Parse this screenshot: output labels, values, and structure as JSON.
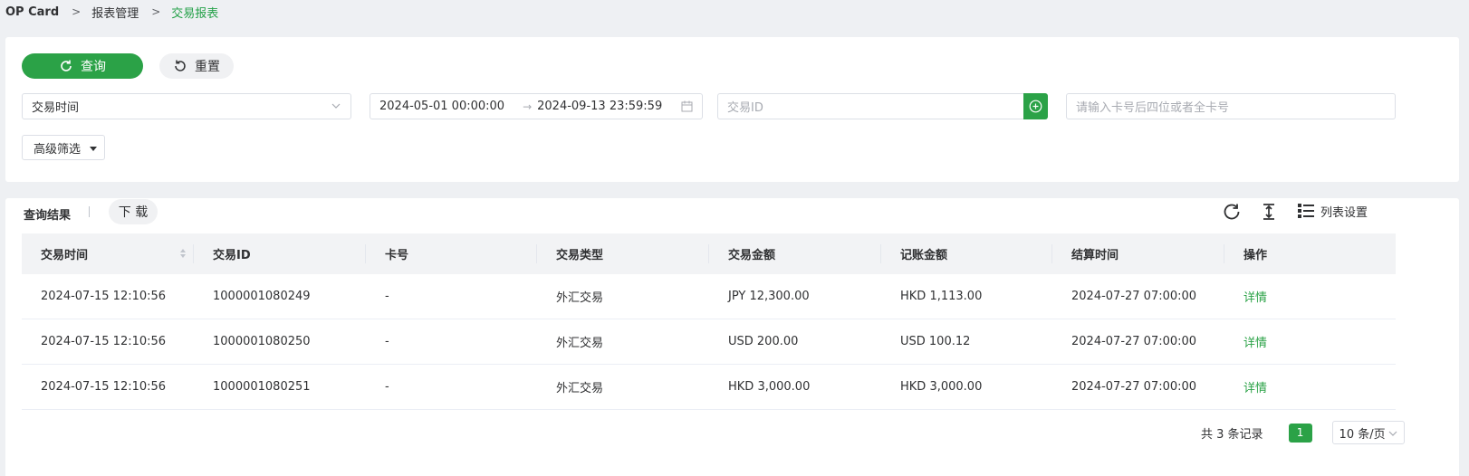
{
  "breadcrumb": {
    "root": "OP Card",
    "parent": "报表管理",
    "current": "交易报表",
    "separator": ">"
  },
  "filter": {
    "query_label": "查询",
    "reset_label": "重置",
    "time_type_value": "交易时间",
    "date_start": "2024-05-01 00:00:00",
    "date_end": "2024-09-13 23:59:59",
    "date_arrow": "→",
    "txn_id_placeholder": "交易ID",
    "card_placeholder": "请输入卡号后四位或者全卡号",
    "advanced_label": "高级筛选"
  },
  "results": {
    "title": "查询结果",
    "download_label": "下 载",
    "column_settings_label": "列表设置",
    "columns": [
      "交易时间",
      "交易ID",
      "卡号",
      "交易类型",
      "交易金额",
      "记账金额",
      "结算时间",
      "操作"
    ],
    "rows": [
      [
        "2024-07-15 12:10:56",
        "1000001080249",
        "-",
        "外汇交易",
        "JPY 12,300.00",
        "HKD 1,113.00",
        "2024-07-27 07:00:00",
        "详情"
      ],
      [
        "2024-07-15 12:10:56",
        "1000001080250",
        "-",
        "外汇交易",
        "USD 200.00",
        "USD 100.12",
        "2024-07-27 07:00:00",
        "详情"
      ],
      [
        "2024-07-15 12:10:56",
        "1000001080251",
        "-",
        "外汇交易",
        "HKD 3,000.00",
        "HKD 3,000.00",
        "2024-07-27 07:00:00",
        "详情"
      ]
    ]
  },
  "pagination": {
    "total_text": "共 3 条记录",
    "current_page": "1",
    "page_size": "10 条/页"
  },
  "colors": {
    "accent": "#2ba247",
    "page_bg": "#eef0f3"
  }
}
